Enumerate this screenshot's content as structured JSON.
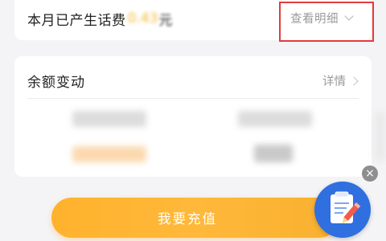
{
  "summary": {
    "charge_label": "本月已产生话费",
    "charge_amount": "0.43",
    "charge_unit": "元",
    "view_detail_label": "查看明细"
  },
  "balance": {
    "title": "余额变动",
    "details_label": "详情"
  },
  "actions": {
    "recharge_label": "我要充值",
    "close_glyph": "×"
  },
  "icons": {
    "view_detail": "chevron-down-icon",
    "details": "chevron-right-icon",
    "close": "close-icon",
    "fab": "edit-note-icon"
  },
  "colors": {
    "accent_orange": "#ffb22d",
    "amount_yellow": "#f5b52c",
    "highlight_red": "#e33a3a",
    "fab_blue": "#2f6fe0"
  }
}
